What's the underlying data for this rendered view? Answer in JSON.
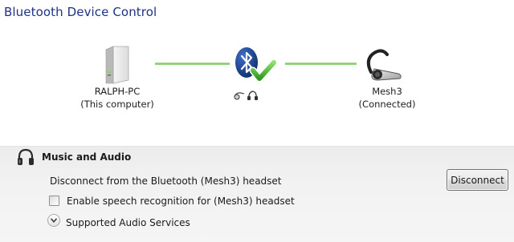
{
  "window": {
    "title": "Bluetooth Device Control"
  },
  "diagram": {
    "computer": {
      "name": "RALPH-PC",
      "note": "(This computer)",
      "icon": "computer-tower-icon"
    },
    "link": {
      "icon": "bluetooth-connected-check-icon",
      "status_color": "#5fbf4a",
      "mini_icons": [
        "headset-mini-icon",
        "headset-mini-icon"
      ]
    },
    "device": {
      "name": "Mesh3",
      "note": "(Connected)",
      "icon": "bluetooth-headset-icon"
    }
  },
  "panel": {
    "heading": "Music and Audio",
    "heading_icon": "headphones-icon",
    "disconnect_text": "Disconnect from the Bluetooth (Mesh3) headset",
    "disconnect_button": "Disconnect",
    "speech_checkbox_label": "Enable speech recognition for (Mesh3) headset",
    "speech_checkbox_checked": false,
    "services_label": "Supported Audio Services",
    "services_expander_icon": "chevron-down-icon"
  },
  "colors": {
    "title": "#1e3287",
    "bluetooth": "#1b3f8a",
    "check": "#4caf2d",
    "link_line": "#79c962"
  }
}
